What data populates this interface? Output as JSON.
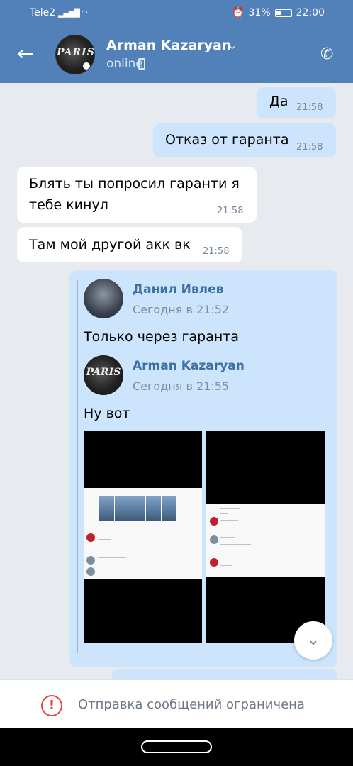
{
  "status_bar": {
    "carrier": "Tele2",
    "battery": "31%",
    "time": "22:00"
  },
  "header": {
    "contact_name": "Arman Kazaryan",
    "contact_status": "online",
    "avatar_text": "PARIS"
  },
  "messages": [
    {
      "direction": "out",
      "text": "Да",
      "time": "21:58"
    },
    {
      "direction": "out",
      "text": "Отказ от гаранта",
      "time": "21:58"
    },
    {
      "direction": "in",
      "text_line1": "Блять ты попросил гаранти я",
      "text_line2": "тебе кинул",
      "time": "21:58"
    },
    {
      "direction": "in",
      "text": "Там мой другой акк вк",
      "time": "21:58"
    }
  ],
  "forwarded": [
    {
      "author": "Данил Ивлев",
      "date": "Сегодня в 21:52",
      "text": "Только через гаранта"
    },
    {
      "author": "Arman Kazaryan",
      "date": "Сегодня в 21:55",
      "text": "Ну вот",
      "avatar_text": "PARIS"
    }
  ],
  "footer": {
    "notice": "Отправка сообщений ограничена"
  },
  "colors": {
    "header_bg": "#5181b8",
    "outgoing_bubble": "#cce4fc",
    "incoming_bubble": "#ffffff",
    "chat_bg": "#e7ebf0",
    "warning": "#e64646"
  },
  "icons": [
    "back-arrow-icon",
    "chevron-down-icon",
    "phone-icon",
    "call-icon",
    "chevron-down-circle-icon",
    "warning-icon"
  ]
}
